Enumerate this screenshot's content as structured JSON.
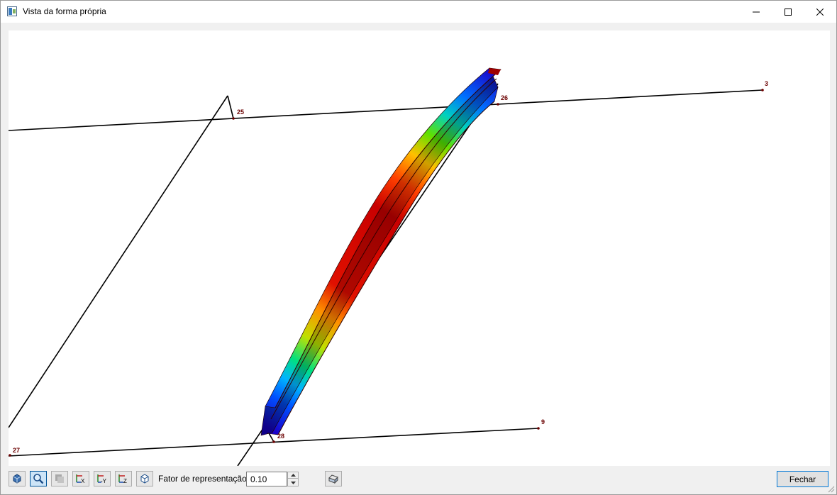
{
  "window": {
    "title": "Vista da forma própria"
  },
  "nodes": {
    "n25": "25",
    "n26": "26",
    "n3": "3",
    "n9": "9",
    "n28": "28",
    "n27": "27"
  },
  "toolbar": {
    "factor_label": "Fator de representação:",
    "factor_value": "0.10",
    "close_label": "Fechar",
    "buttons": {
      "view": "view-icon",
      "zoom": "zoom-icon",
      "render": "render-icon",
      "view_x": "X",
      "view_y": "-Y",
      "view_z": "Z",
      "isometric": "isometric-icon",
      "print": "print-icon"
    }
  },
  "colors": {
    "accent": "#0078d7",
    "node_label": "#6b0000",
    "member_line": "#000000",
    "contour_low": "#1a00c8",
    "contour_high": "#d00000"
  }
}
